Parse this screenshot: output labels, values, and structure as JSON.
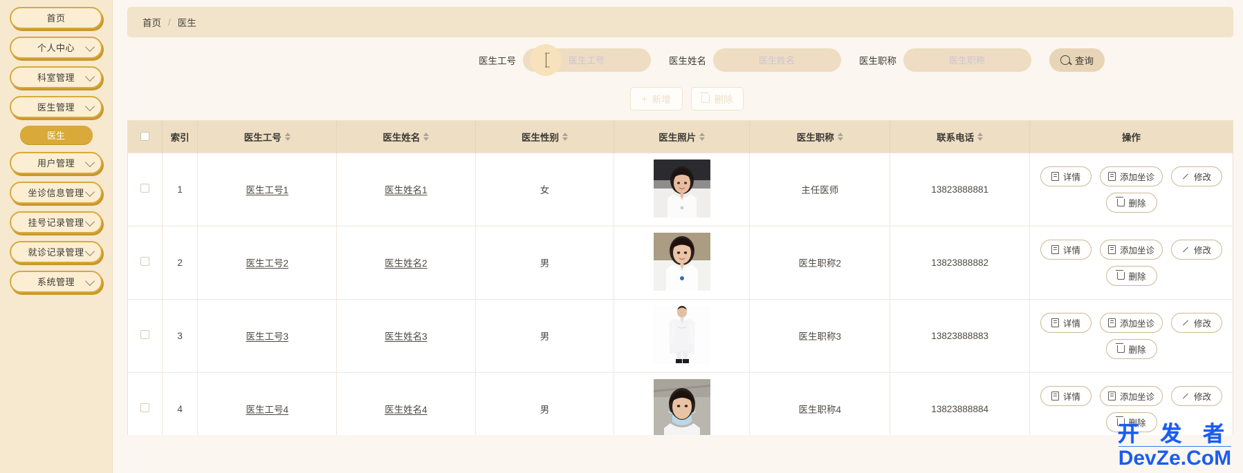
{
  "sidebar": {
    "items": [
      {
        "label": "首页",
        "name": "home",
        "expandable": false
      },
      {
        "label": "个人中心",
        "name": "personal-center",
        "expandable": true
      },
      {
        "label": "科室管理",
        "name": "department-management",
        "expandable": true
      },
      {
        "label": "医生管理",
        "name": "doctor-management",
        "expandable": true
      }
    ],
    "active_sub": {
      "label": "医生",
      "name": "doctor"
    },
    "items_after": [
      {
        "label": "用户管理",
        "name": "user-management",
        "expandable": true
      },
      {
        "label": "坐诊信息管理",
        "name": "clinic-info-management",
        "expandable": true
      },
      {
        "label": "挂号记录管理",
        "name": "registration-record-management",
        "expandable": true
      },
      {
        "label": "就诊记录管理",
        "name": "visit-record-management",
        "expandable": true
      },
      {
        "label": "系统管理",
        "name": "system-management",
        "expandable": true
      }
    ]
  },
  "breadcrumb": {
    "root": "首页",
    "separator": "/",
    "current": "医生"
  },
  "search": {
    "fields": [
      {
        "label": "医生工号",
        "placeholder": "医生工号",
        "value": ""
      },
      {
        "label": "医生姓名",
        "placeholder": "医生姓名",
        "value": ""
      },
      {
        "label": "医生职称",
        "placeholder": "医生职称",
        "value": ""
      }
    ],
    "query_button": "查询"
  },
  "toolbar": {
    "add_label": "新增",
    "add_icon": "plus-icon",
    "delete_label": "删除",
    "delete_icon": "trash-icon"
  },
  "table": {
    "columns": [
      {
        "label": "",
        "name": "select-all",
        "sortable": false
      },
      {
        "label": "索引",
        "name": "index",
        "sortable": false
      },
      {
        "label": "医生工号",
        "name": "doctor-id",
        "sortable": true
      },
      {
        "label": "医生姓名",
        "name": "doctor-name",
        "sortable": true
      },
      {
        "label": "医生性别",
        "name": "doctor-gender",
        "sortable": true
      },
      {
        "label": "医生照片",
        "name": "doctor-photo",
        "sortable": true
      },
      {
        "label": "医生职称",
        "name": "doctor-title",
        "sortable": true
      },
      {
        "label": "联系电话",
        "name": "contact-phone",
        "sortable": true
      },
      {
        "label": "操作",
        "name": "operations",
        "sortable": false
      }
    ],
    "rows": [
      {
        "index": "1",
        "doctor_id": "医生工号1",
        "doctor_name": "医生姓名1",
        "gender": "女",
        "title": "主任医师",
        "phone": "13823888881",
        "photo": "female-doctor-portrait"
      },
      {
        "index": "2",
        "doctor_id": "医生工号2",
        "doctor_name": "医生姓名2",
        "gender": "男",
        "title": "医生职称2",
        "phone": "13823888882",
        "photo": "female-doctor-portrait-2"
      },
      {
        "index": "3",
        "doctor_id": "医生工号3",
        "doctor_name": "医生姓名3",
        "gender": "男",
        "title": "医生职称3",
        "phone": "13823888883",
        "photo": "doctor-full-body-whitecoat"
      },
      {
        "index": "4",
        "doctor_id": "医生工号4",
        "doctor_name": "医生姓名4",
        "gender": "男",
        "title": "医生职称4",
        "phone": "13823888884",
        "photo": "masked-doctor-portrait"
      }
    ],
    "ops": {
      "detail": "详情",
      "add_clinic": "添加坐诊",
      "edit": "修改",
      "delete": "删除"
    }
  },
  "watermark": {
    "line1": "开 发 者",
    "line2": "DevZe.CoM"
  },
  "colors": {
    "sidebar_bg": "#f6e9cf",
    "menu_border": "#d9a93a",
    "accent": "#d9a93a",
    "header_bg": "#eedfc4",
    "breadcrumb_bg": "#f2e3cb",
    "watermark": "#1a5cf0"
  }
}
